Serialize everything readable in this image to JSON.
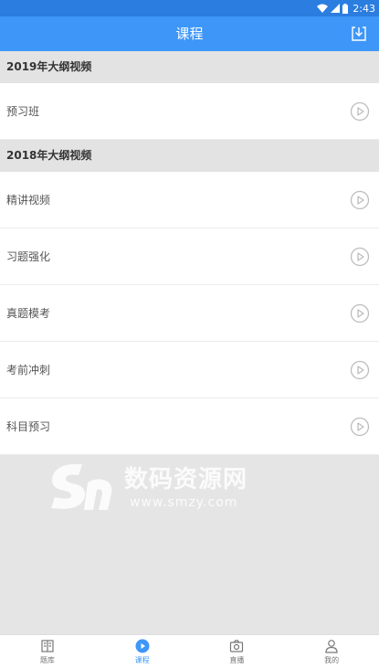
{
  "status_bar": {
    "time": "2:43"
  },
  "header": {
    "title": "课程"
  },
  "sections": [
    {
      "title": "2019年大纲视频",
      "items": [
        {
          "label": "预习班"
        }
      ]
    },
    {
      "title": "2018年大纲视频",
      "items": [
        {
          "label": "精讲视频"
        },
        {
          "label": "习题强化"
        },
        {
          "label": "真题模考"
        },
        {
          "label": "考前冲刺"
        },
        {
          "label": "科目预习"
        }
      ]
    }
  ],
  "watermark": {
    "text": "数码资源网",
    "url": "www.smzy.com"
  },
  "tabs": [
    {
      "label": "题库",
      "icon": "book-icon"
    },
    {
      "label": "课程",
      "icon": "play-circle-icon",
      "active": true
    },
    {
      "label": "直播",
      "icon": "camera-icon"
    },
    {
      "label": "我的",
      "icon": "user-icon"
    }
  ],
  "colors": {
    "accent": "#3e97f8",
    "status_bar": "#2b7de0",
    "background": "#e5e5e5"
  }
}
